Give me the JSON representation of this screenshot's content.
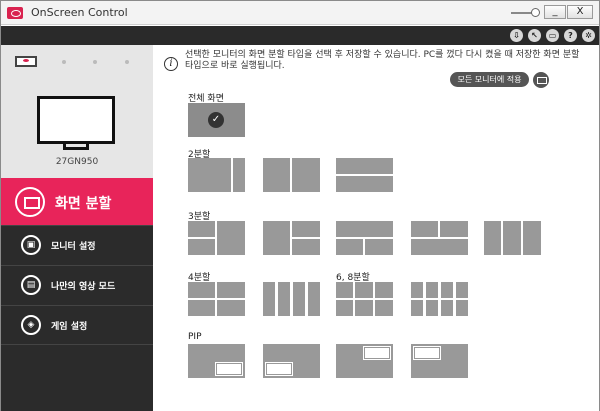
{
  "window": {
    "title": "OnScreen Control",
    "minimize_label": "_",
    "close_label": "X"
  },
  "toolbar": {
    "icons": [
      "download-icon",
      "cursor-icon",
      "display-icon",
      "help-icon",
      "settings-icon"
    ],
    "help_label": "?"
  },
  "sidebar": {
    "model": "27GN950",
    "active_item": {
      "label": "화면 분할",
      "icon": "screen-split-icon"
    },
    "items": [
      {
        "label": "모니터 설정",
        "icon": "monitor-settings-icon"
      },
      {
        "label": "나만의 영상 모드",
        "icon": "picture-mode-icon"
      },
      {
        "label": "게임 설정",
        "icon": "gamepad-icon"
      }
    ]
  },
  "main": {
    "info_text": "선택한 모니터의 화면 분할 타입을 선택 후 저장할 수 있습니다. PC를 껐다 다시 켰을 때 저장한 화면 분할 타입으로 바로 실행됩니다.",
    "info_glyph": "i",
    "apply_all_button": "모든 모니터에 적용",
    "sections": {
      "full": "전체 화면",
      "split2": "2분할",
      "split3": "3분할",
      "split4": "4분할",
      "split68": "6, 8분할",
      "pip": "PIP"
    },
    "check_glyph": "✓"
  },
  "colors": {
    "accent": "#e8245a",
    "sidebar_bg": "#2b2b2b",
    "toolbar_bg": "#2a2a2a",
    "tile": "#999999"
  }
}
